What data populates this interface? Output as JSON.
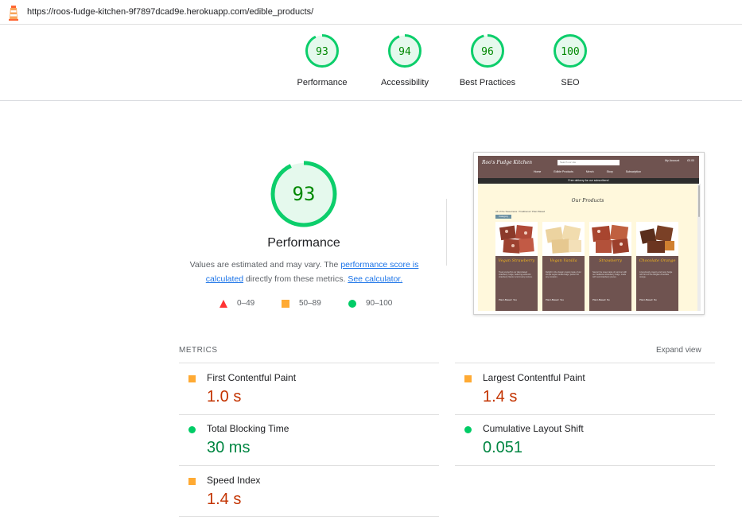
{
  "url": "https://roos-fudge-kitchen-9f7897dcad9e.herokuapp.com/edible_products/",
  "top_scores": [
    {
      "label": "Performance",
      "score": "93"
    },
    {
      "label": "Accessibility",
      "score": "94"
    },
    {
      "label": "Best Practices",
      "score": "96"
    },
    {
      "label": "SEO",
      "score": "100"
    }
  ],
  "main": {
    "score": "93",
    "title": "Performance",
    "desc_prefix": "Values are estimated and may vary. The ",
    "desc_link1": "performance score is calculated",
    "desc_middle": " directly from these metrics. ",
    "desc_link2": "See calculator."
  },
  "legend": {
    "fail": "0–49",
    "average": "50–89",
    "pass": "90–100"
  },
  "colors": {
    "pass": "#0cce6b",
    "average": "#ffa400",
    "fail": "#ff4e42"
  },
  "thumbnail": {
    "brand": "Roo's Fudge Kitchen",
    "search_placeholder": "Search our site",
    "nav": [
      "Home",
      "Edible Products",
      "Merch",
      "Story",
      "Subscription"
    ],
    "icons": [
      "My Account",
      "£0.00"
    ],
    "banner": "Free delivery for our subscribers!",
    "heading": "Our Products",
    "breadcrumb": "All of the Sweetness / Traditional / Plant Based",
    "pill": "Category",
    "cards": [
      {
        "title": "Vegan Strawberry",
        "text": "Treat yourself to our plant-based strawberry fudge, featuring authentic strawberry flavour and creamy texture.",
        "foot": "Plant-Based: Yes"
      },
      {
        "title": "Vegan Vanilla",
        "text": "Delight in the classic creamy taste of our simple vegan vanilla fudge, perfect for any occasion.",
        "foot": "Plant-Based: Yes"
      },
      {
        "title": "Strawberry",
        "text": "Savour the sweet taste of summer with our traditional strawberry fudge, made with real strawberry pieces.",
        "foot": "Plant-Based: No"
      },
      {
        "title": "Chocolate Orange",
        "text": "A luxuriously creamy and zesty fudge with hint of fine Belgian chocolate orange.",
        "foot": "Plant-Based: No"
      }
    ]
  },
  "metrics": {
    "header": "METRICS",
    "expand": "Expand view",
    "items": [
      {
        "name": "First Contentful Paint",
        "value": "1.0 s",
        "rating": "average"
      },
      {
        "name": "Largest Contentful Paint",
        "value": "1.4 s",
        "rating": "average"
      },
      {
        "name": "Total Blocking Time",
        "value": "30 ms",
        "rating": "pass"
      },
      {
        "name": "Cumulative Layout Shift",
        "value": "0.051",
        "rating": "pass"
      },
      {
        "name": "Speed Index",
        "value": "1.4 s",
        "rating": "average"
      }
    ]
  }
}
